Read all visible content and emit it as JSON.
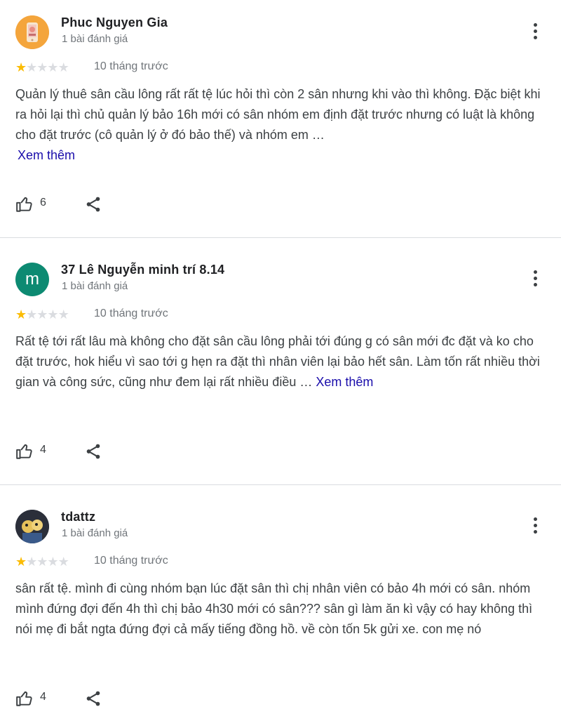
{
  "reviews": [
    {
      "author": "Phuc Nguyen Gia",
      "review_count": "1 bài đánh giá",
      "avatar": {
        "type": "image",
        "icon": "phone-illustration-avatar",
        "bg": "#f4a53c"
      },
      "rating": 1,
      "max_rating": 5,
      "time": "10 tháng trước",
      "text": "Quản lý thuê sân cầu lông rất rất tệ lúc hỏi thì còn 2 sân nhưng khi vào thì không. Đặc biệt khi ra hỏi lại thì chủ quản lý bảo 16h mới có sân nhóm em định đặt trước nhưng có luật là không cho đặt trước (cô quản lý ở đó bảo thế) và nhóm em …",
      "see_more": "Xem thêm",
      "likes": "6"
    },
    {
      "author": "37 Lê Nguyễn minh trí 8.14",
      "review_count": "1 bài đánh giá",
      "avatar": {
        "type": "letter",
        "letter": "m",
        "bg": "#0d8a72"
      },
      "rating": 1,
      "max_rating": 5,
      "time": "10 tháng trước",
      "text": "Rất tệ tới rất lâu mà không cho đặt sân cầu lông phải tới đúng g có sân mới đc đặt và ko cho đặt trước, hok hiểu vì sao tới g hẹn ra đặt thì nhân viên lại bảo hết sân. Làm tốn rất nhiều thời gian và công sức, cũng như đem lại rất nhiều điều …",
      "see_more": "Xem thêm",
      "likes": "4"
    },
    {
      "author": "tdattz",
      "review_count": "1 bài đánh giá",
      "avatar": {
        "type": "image",
        "icon": "cartoon-character-avatar",
        "bg": "#2b2f3a"
      },
      "rating": 1,
      "max_rating": 5,
      "time": "10 tháng trước",
      "text": "sân rất tệ. mình đi cùng nhóm bạn lúc đặt sân thì chị nhân viên có bảo 4h mới có sân. nhóm mình đứng đợi đến 4h thì chị bảo 4h30 mới có sân??? sân gì làm ăn kì vậy có hay không thì nói mẹ đi bắt ngta đứng đợi cả mấy tiếng đồng hồ. về còn tốn 5k gửi xe. con mẹ nó",
      "see_more": "",
      "likes": "4"
    }
  ],
  "colors": {
    "star_on": "#fbbc04",
    "star_off": "#dadce0",
    "link": "#1a0dab",
    "divider": "#dadce0"
  }
}
